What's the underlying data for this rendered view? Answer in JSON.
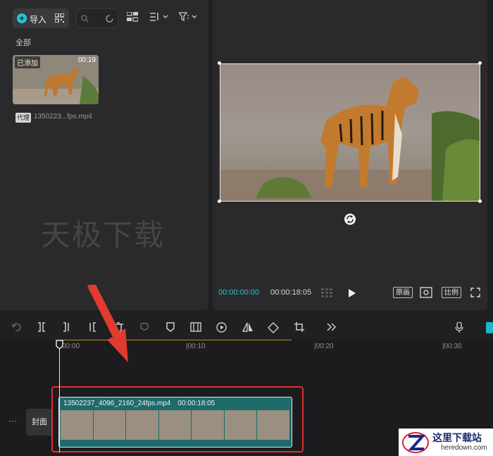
{
  "media": {
    "import_label": "导入",
    "all_label": "全部",
    "item": {
      "added_badge": "已添加",
      "duration": "00:19",
      "proxy_tag": "代理",
      "file_name": "1350223...fps.mp4"
    }
  },
  "watermark": "天极下载",
  "preview": {
    "time_current": "00:00:00:00",
    "time_total": "00:00:18:05",
    "btn_original": "原画",
    "btn_ratio": "比例"
  },
  "timeline": {
    "ticks": [
      "00:00",
      "|00:10",
      "|00:20",
      "|00:30"
    ],
    "cover_label": "封面",
    "more": "···",
    "clip_name": "13502237_4096_2160_24fps.mp4",
    "clip_duration": "00:00:18:05"
  },
  "brand": {
    "cn": "这里下载站",
    "en": "heredown.com"
  },
  "colors": {
    "accent": "#27c2d6",
    "clip": "#1d6b6b",
    "highlight": "#e03030"
  }
}
